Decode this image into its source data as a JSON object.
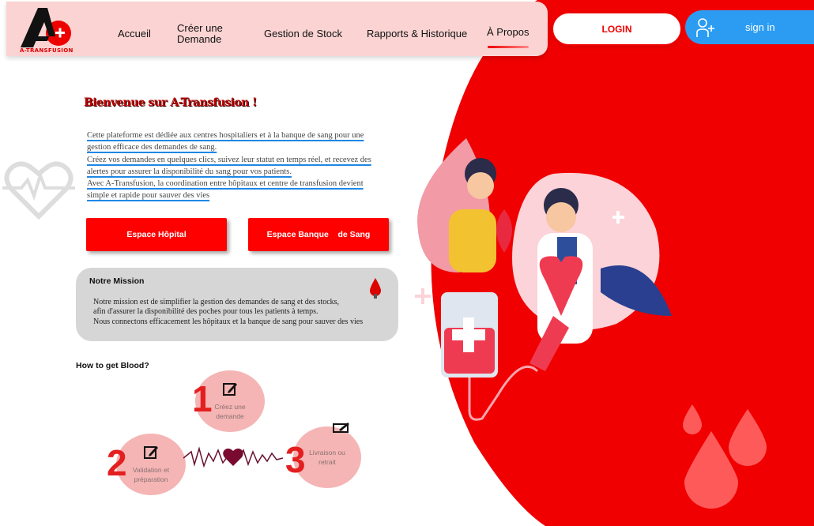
{
  "brand": {
    "logo_text": "A-TRANSFUSION"
  },
  "nav": {
    "items": [
      {
        "label": "Accueil"
      },
      {
        "label": "Créer une Demande"
      },
      {
        "label": "Gestion de Stock"
      },
      {
        "label": "Rapports & Historique"
      },
      {
        "label": "À Propos"
      }
    ],
    "active": "À Propos"
  },
  "auth": {
    "login_label": "LOGIN",
    "signin_label": "sign in"
  },
  "hero": {
    "welcome": "Bienvenue sur A-Transfusion !",
    "intro_lines": [
      "Cette plateforme est dédiée aux centres hospitaliers et à la banque de sang pour une",
      "gestion efficace des demandes de sang.",
      "Créez vos demandes en quelques clics, suivez leur statut en temps réel, et recevez des",
      "alertes pour assurer la disponibilité du sang pour vos patients.",
      "Avec A-Transfusion, la coordination entre hôpitaux et centre de transfusion devient",
      "simple et rapide pour sauver des vies"
    ]
  },
  "buttons": {
    "hospital": "Espace Hôpital",
    "bank": "Espace Banque    de Sang"
  },
  "mission": {
    "title": "Notre Mission",
    "text": "Notre mission est de simplifier la gestion des demandes de sang et des stocks,\n  afin d'assurer la disponibilité des poches pour tous les patients à temps.\n  Nous connectons efficacement les hôpitaux et la banque de sang pour sauver des vies"
  },
  "howto": {
    "title": "How to get Blood?",
    "steps": [
      {
        "num": "1",
        "line1": "Créez une",
        "line2": "demande"
      },
      {
        "num": "2",
        "line1": "Validation et",
        "line2": "préparation"
      },
      {
        "num": "3",
        "line1": "Livraison ou",
        "line2": "retrait"
      }
    ]
  },
  "colors": {
    "accent": "#ff0000",
    "nav_bg": "#fbd3d3",
    "signin": "#2c9cf2",
    "mission_bg": "#d6d6d6",
    "step_bg": "#f5b5b5"
  },
  "icons": [
    "heart-pulse-icon",
    "blood-drop-icon",
    "edit-icon",
    "user-plus-icon",
    "heartbeat-line-icon"
  ]
}
